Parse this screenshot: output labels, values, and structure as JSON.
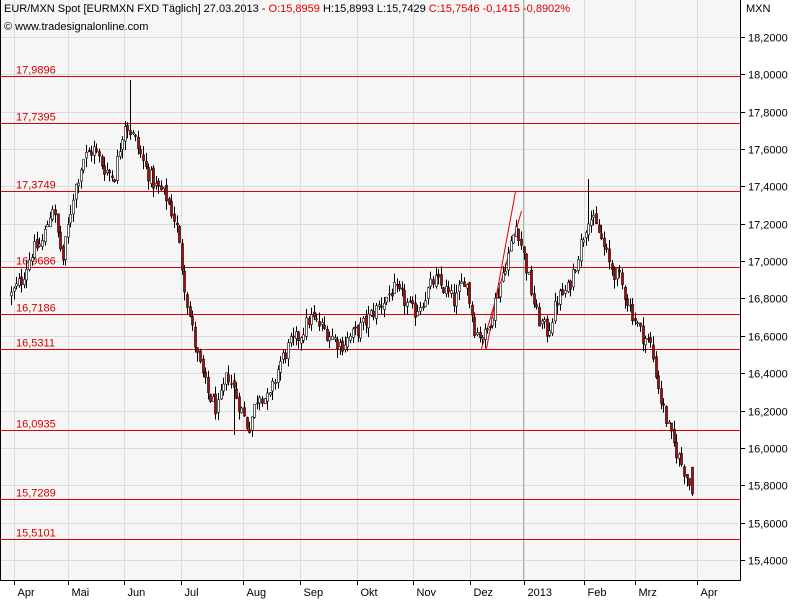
{
  "header": {
    "title": "EUR/MXN Spot [EURMXN FXD  Täglich] 27.03.2013 - ",
    "open": "O:15,8959",
    "high": "H:15,8993",
    "low": "L:15,7429",
    "close": "C:15,7546",
    "change": "-0,1415",
    "change_pct": "-0,8902%",
    "watermark": "© www.tradesignalonline.com"
  },
  "colors": {
    "background": "#f6f6f6",
    "grid": "#dcdcdc",
    "level_line": "#e00000",
    "level_text": "#d00000",
    "candle_up": "#ffffff",
    "candle_down": "#c00000",
    "candle_outline": "#000000",
    "change_text": "#e00000"
  },
  "chart_data": {
    "type": "candlestick",
    "title": "EUR/MXN Spot [EURMXN FXD  Täglich] 27.03.2013",
    "currency_label": "MXN",
    "ylim": [
      15.31,
      18.41
    ],
    "y_ticks": [
      "18,2000",
      "18,0000",
      "17,8000",
      "17,6000",
      "17,4000",
      "17,2000",
      "17,0000",
      "16,8000",
      "16,6000",
      "16,4000",
      "16,2000",
      "16,0000",
      "15,8000",
      "15,6000",
      "15,4000"
    ],
    "y_tick_values": [
      18.2,
      18.0,
      17.8,
      17.6,
      17.4,
      17.2,
      17.0,
      16.8,
      16.6,
      16.4,
      16.2,
      16.0,
      15.8,
      15.6,
      15.4
    ],
    "x_ticks": [
      {
        "label": "Apr",
        "t": 0.5
      },
      {
        "label": "Mai",
        "t": 11
      },
      {
        "label": "Jun",
        "t": 22
      },
      {
        "label": "Jul",
        "t": 33
      },
      {
        "label": "Aug",
        "t": 45
      },
      {
        "label": "Sep",
        "t": 56
      },
      {
        "label": "Okt",
        "t": 67
      },
      {
        "label": "Nov",
        "t": 78
      },
      {
        "label": "Dez",
        "t": 89
      },
      {
        "label": "2013",
        "t": 99.5
      },
      {
        "label": "Feb",
        "t": 111
      },
      {
        "label": "Mrz",
        "t": 121
      },
      {
        "label": "Apr",
        "t": 133
      }
    ],
    "x_range": [
      -2,
      138
    ],
    "levels": [
      {
        "label": "17,9896",
        "value": 17.9896
      },
      {
        "label": "17,7395",
        "value": 17.7395
      },
      {
        "label": "17,3749",
        "value": 17.3749
      },
      {
        "label": "16,9686",
        "value": 16.9686
      },
      {
        "label": "16,7186",
        "value": 16.7186
      },
      {
        "label": "16,5311",
        "value": 16.5311
      },
      {
        "label": "16,0935",
        "value": 16.0935
      },
      {
        "label": "15,7289",
        "value": 15.7289
      },
      {
        "label": "15,5101",
        "value": 15.5101
      }
    ],
    "trend_channel": [
      {
        "t1": 91.2,
        "v1": 16.53,
        "t2": 99.0,
        "v2": 17.27
      },
      {
        "t1": 92.2,
        "v1": 16.53,
        "t2": 97.8,
        "v2": 17.37
      }
    ],
    "year_marker_t": 99.2,
    "anchors": [
      [
        0,
        16.82
      ],
      [
        2,
        16.9
      ],
      [
        4,
        17.05
      ],
      [
        6,
        17.1
      ],
      [
        8,
        17.3
      ],
      [
        10,
        17.0
      ],
      [
        12,
        17.35
      ],
      [
        14,
        17.55
      ],
      [
        16,
        17.6
      ],
      [
        18,
        17.5
      ],
      [
        20,
        17.45
      ],
      [
        22,
        17.75
      ],
      [
        24,
        17.65
      ],
      [
        26,
        17.5
      ],
      [
        28,
        17.4
      ],
      [
        30,
        17.35
      ],
      [
        32,
        17.2
      ],
      [
        34,
        16.8
      ],
      [
        36,
        16.5
      ],
      [
        38,
        16.3
      ],
      [
        40,
        16.2
      ],
      [
        42,
        16.4
      ],
      [
        44,
        16.25
      ],
      [
        46,
        16.1
      ],
      [
        48,
        16.3
      ],
      [
        50,
        16.25
      ],
      [
        52,
        16.45
      ],
      [
        54,
        16.55
      ],
      [
        56,
        16.6
      ],
      [
        58,
        16.7
      ],
      [
        60,
        16.65
      ],
      [
        62,
        16.6
      ],
      [
        64,
        16.55
      ],
      [
        66,
        16.6
      ],
      [
        68,
        16.65
      ],
      [
        70,
        16.72
      ],
      [
        72,
        16.78
      ],
      [
        74,
        16.85
      ],
      [
        76,
        16.8
      ],
      [
        78,
        16.72
      ],
      [
        80,
        16.8
      ],
      [
        82,
        16.9
      ],
      [
        84,
        16.85
      ],
      [
        86,
        16.78
      ],
      [
        88,
        16.92
      ],
      [
        90,
        16.62
      ],
      [
        92,
        16.6
      ],
      [
        94,
        16.8
      ],
      [
        96,
        17.0
      ],
      [
        98,
        17.2
      ],
      [
        100,
        16.95
      ],
      [
        102,
        16.7
      ],
      [
        104,
        16.62
      ],
      [
        106,
        16.8
      ],
      [
        108,
        16.85
      ],
      [
        110,
        17.05
      ],
      [
        112,
        17.25
      ],
      [
        114,
        17.15
      ],
      [
        116,
        16.98
      ],
      [
        118,
        16.9
      ],
      [
        120,
        16.75
      ],
      [
        122,
        16.62
      ],
      [
        124,
        16.55
      ],
      [
        126,
        16.25
      ],
      [
        128,
        16.05
      ],
      [
        129,
        15.98
      ],
      [
        131,
        15.85
      ],
      [
        132,
        15.76
      ]
    ],
    "extremes": [
      {
        "t": 23,
        "high": 17.97
      },
      {
        "t": 43,
        "low": 16.07
      },
      {
        "t": 112,
        "high": 17.44
      },
      {
        "t": 132,
        "low": 15.745
      }
    ],
    "last_candle": {
      "t": 132,
      "open": 15.8959,
      "high": 15.8993,
      "low": 15.7429,
      "close": 15.7546
    }
  }
}
